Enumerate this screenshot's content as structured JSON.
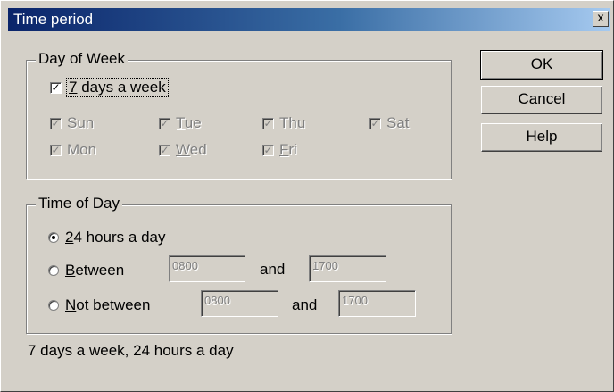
{
  "window": {
    "title": "Time period",
    "close_label": "x"
  },
  "day_group": {
    "legend": "Day of Week",
    "all_week": {
      "label": "7 days a week",
      "mnemonic": "7",
      "rest": " days a week",
      "checked": true
    },
    "days": [
      {
        "key": "sun",
        "label": "Sun",
        "mnemonic": "",
        "rest": "Sun"
      },
      {
        "key": "tue",
        "label": "Tue",
        "mnemonic": "T",
        "rest": "ue"
      },
      {
        "key": "thu",
        "label": "Thu",
        "mnemonic": "",
        "rest": "Thu"
      },
      {
        "key": "sat",
        "label": "Sat",
        "mnemonic": "",
        "rest": "Sat"
      },
      {
        "key": "mon",
        "label": "Mon",
        "mnemonic": "",
        "rest": "Mon"
      },
      {
        "key": "wed",
        "label": "Wed",
        "mnemonic": "W",
        "rest": "ed"
      },
      {
        "key": "fri",
        "label": "Fri",
        "mnemonic": "F",
        "rest": "ri"
      }
    ]
  },
  "time_group": {
    "legend": "Time of Day",
    "opt_24": {
      "mnemonic": "2",
      "rest": "4 hours a day",
      "selected": true
    },
    "opt_between": {
      "mnemonic": "B",
      "rest": "etween",
      "from": "0800",
      "and": "and",
      "to": "1700"
    },
    "opt_not_between": {
      "mnemonic": "N",
      "rest": "ot between",
      "from": "0800",
      "and": "and",
      "to": "1700"
    }
  },
  "summary": "7 days a week, 24 hours a day",
  "buttons": {
    "ok": "OK",
    "cancel": "Cancel",
    "help": "Help"
  },
  "check_glyph": "✓"
}
